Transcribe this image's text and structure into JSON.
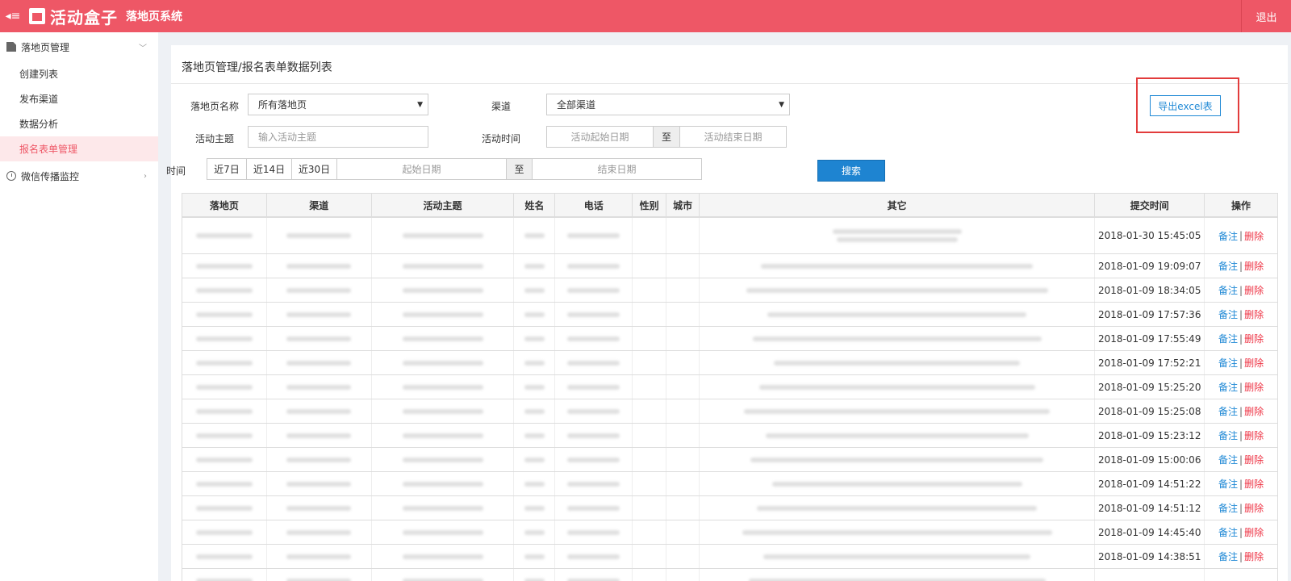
{
  "header": {
    "menu_icon": "menu-toggle-icon",
    "logo_text": "活动盒子",
    "system_title": "落地页系统",
    "logout_label": "退出"
  },
  "sidebar": {
    "groups": [
      {
        "label": "落地页管理",
        "icon": "document-icon",
        "expanded": true,
        "items": [
          "创建列表",
          "发布渠道",
          "数据分析",
          "报名表单管理"
        ],
        "active_item": "报名表单管理"
      },
      {
        "label": "微信传播监控",
        "icon": "clock-icon",
        "expanded": false
      }
    ]
  },
  "page": {
    "breadcrumb": "落地页管理/报名表单数据列表",
    "filters": {
      "landing_label": "落地页名称",
      "landing_value": "所有落地页",
      "channel_label": "渠道",
      "channel_value": "全部渠道",
      "topic_label": "活动主题",
      "topic_placeholder": "输入活动主题",
      "time_label": "活动时间",
      "start_placeholder": "活动起始日期",
      "to_label": "至",
      "end_placeholder": "活动结束日期",
      "submit_time_label": "时间",
      "quick_ranges": [
        "近7日",
        "近14日",
        "近30日"
      ],
      "submit_start_placeholder": "起始日期",
      "submit_end_placeholder": "结束日期",
      "search_label": "搜索"
    },
    "export_label": "导出excel表",
    "colors": {
      "brand": "#ee5766",
      "primary": "#1e84d1",
      "danger": "#ee3344",
      "highlight": "#e23c3c"
    }
  },
  "table": {
    "headers": [
      "落地页",
      "渠道",
      "活动主题",
      "姓名",
      "电话",
      "性别",
      "城市",
      "其它",
      "提交时间",
      "操作"
    ],
    "note_label": "备注",
    "separator": "|",
    "delete_label": "删除",
    "rows": [
      {
        "time": "2018-01-30 15:45:05"
      },
      {
        "time": "2018-01-09 19:09:07"
      },
      {
        "time": "2018-01-09 18:34:05"
      },
      {
        "time": "2018-01-09 17:57:36"
      },
      {
        "time": "2018-01-09 17:55:49"
      },
      {
        "time": "2018-01-09 17:52:21"
      },
      {
        "time": "2018-01-09 15:25:20"
      },
      {
        "time": "2018-01-09 15:25:08"
      },
      {
        "time": "2018-01-09 15:23:12"
      },
      {
        "time": "2018-01-09 15:00:06"
      },
      {
        "time": "2018-01-09 14:51:22"
      },
      {
        "time": "2018-01-09 14:51:12"
      },
      {
        "time": "2018-01-09 14:45:40"
      },
      {
        "time": "2018-01-09 14:38:51"
      },
      {
        "time": ""
      }
    ]
  }
}
